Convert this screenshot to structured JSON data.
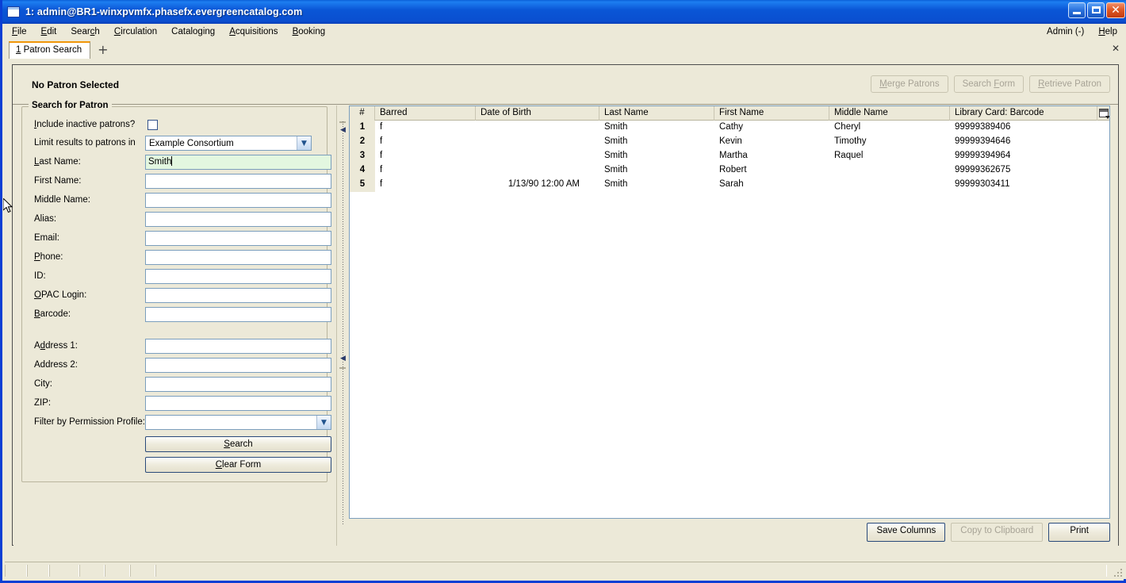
{
  "window": {
    "title": "1: admin@BR1-winxpvmfx.phasefx.evergreencatalog.com",
    "icon": "window-icon",
    "minimize_label": "",
    "maximize_label": "",
    "close_label": "✕"
  },
  "menubar": {
    "items": [
      {
        "label": "File",
        "accel": "F"
      },
      {
        "label": "Edit",
        "accel": "E"
      },
      {
        "label": "Search",
        "accel": "c"
      },
      {
        "label": "Circulation",
        "accel": "C"
      },
      {
        "label": "Cataloging",
        "accel": "g"
      },
      {
        "label": "Acquisitions",
        "accel": "A"
      },
      {
        "label": "Booking",
        "accel": "B"
      }
    ],
    "right_items": [
      {
        "label": "Admin (-)"
      },
      {
        "label": "Help",
        "accel": "H"
      }
    ]
  },
  "tabbar": {
    "tabs": [
      {
        "index": "1",
        "label": "Patron Search"
      }
    ],
    "new_tab_label": "+",
    "close_label": "✕"
  },
  "patron_header": {
    "title": "No Patron Selected",
    "buttons": [
      {
        "label": "Merge Patrons",
        "disabled": true
      },
      {
        "label": "Search Form",
        "disabled": true
      },
      {
        "label": "Retrieve Patron",
        "disabled": true
      }
    ]
  },
  "search_form": {
    "legend": "Search for Patron",
    "include_inactive_label": "Include inactive patrons?",
    "include_inactive_checked": false,
    "limit_results_label": "Limit results to patrons in",
    "limit_results_value": "Example Consortium",
    "fields": [
      {
        "label": "Last Name:",
        "value": "Smith",
        "focused": true
      },
      {
        "label": "First Name:",
        "value": "",
        "focused": false
      },
      {
        "label": "Middle Name:",
        "value": "",
        "focused": false
      },
      {
        "label": "Alias:",
        "value": "",
        "focused": false
      },
      {
        "label": "Email:",
        "value": "",
        "focused": false
      },
      {
        "label": "Phone:",
        "value": "",
        "focused": false
      },
      {
        "label": "ID:",
        "value": "",
        "focused": false
      },
      {
        "label": "OPAC Login:",
        "value": "",
        "focused": false
      },
      {
        "label": "Barcode:",
        "value": "",
        "focused": false
      }
    ],
    "address_fields": [
      {
        "label": "Address 1:",
        "value": ""
      },
      {
        "label": "Address 2:",
        "value": ""
      },
      {
        "label": "City:",
        "value": ""
      },
      {
        "label": "ZIP:",
        "value": ""
      }
    ],
    "permission_profile_label": "Filter by Permission Profile:",
    "permission_profile_value": "",
    "search_button": "Search",
    "clear_button": "Clear Form"
  },
  "results": {
    "columns": [
      {
        "key": "num",
        "label": "#"
      },
      {
        "key": "barred",
        "label": "Barred"
      },
      {
        "key": "dob",
        "label": "Date of Birth"
      },
      {
        "key": "last",
        "label": "Last Name"
      },
      {
        "key": "first",
        "label": "First Name"
      },
      {
        "key": "middle",
        "label": "Middle Name"
      },
      {
        "key": "barcode",
        "label": "Library Card: Barcode"
      }
    ],
    "column_picker_icon": "column-picker-icon",
    "rows": [
      {
        "num": "1",
        "barred": "f",
        "dob": "",
        "last": "Smith",
        "first": "Cathy",
        "middle": "Cheryl",
        "barcode": "99999389406"
      },
      {
        "num": "2",
        "barred": "f",
        "dob": "",
        "last": "Smith",
        "first": "Kevin",
        "middle": "Timothy",
        "barcode": "99999394646"
      },
      {
        "num": "3",
        "barred": "f",
        "dob": "",
        "last": "Smith",
        "first": "Martha",
        "middle": "Raquel",
        "barcode": "99999394964"
      },
      {
        "num": "4",
        "barred": "f",
        "dob": "",
        "last": "Smith",
        "first": "Robert",
        "middle": "",
        "barcode": "99999362675"
      },
      {
        "num": "5",
        "barred": "f",
        "dob": "1/13/90 12:00 AM",
        "last": "Smith",
        "first": "Sarah",
        "middle": "",
        "barcode": "99999303411"
      }
    ],
    "buttons": [
      {
        "label": "Save Columns",
        "disabled": false
      },
      {
        "label": "Copy to Clipboard",
        "disabled": true
      },
      {
        "label": "Print",
        "disabled": false
      }
    ]
  },
  "statusbar": {
    "cells": [
      "",
      "",
      "",
      "",
      "",
      "",
      ""
    ]
  },
  "colors": {
    "titlebar": "#0a4fd0",
    "face": "#ece9d8",
    "accent_tab": "#f0960a",
    "field_focus": "#e3f7e0",
    "border": "#7b9ebd"
  }
}
